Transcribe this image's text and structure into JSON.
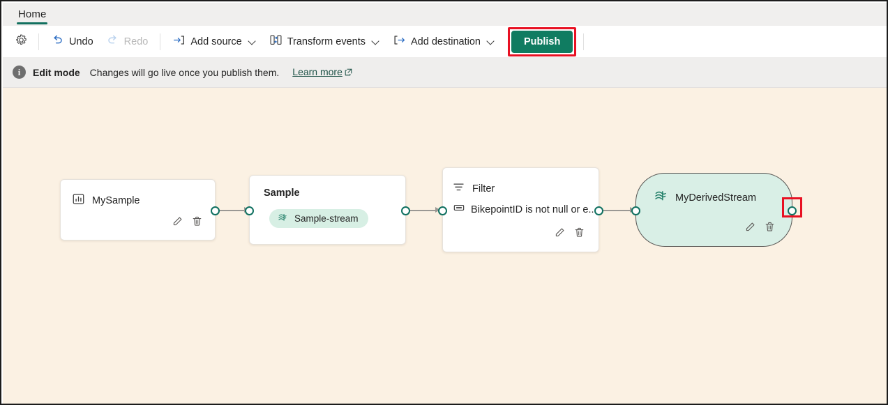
{
  "window": {
    "accent_green": "#107c61",
    "canvas_background": "#fbf1e3",
    "annotation_color": "#e81123"
  },
  "tabstrip": {
    "tabs": [
      {
        "label": "Home",
        "selected": true
      }
    ]
  },
  "toolbar": {
    "settings_label": "Settings",
    "items": [
      {
        "id": "settings",
        "label": "",
        "icon": "gear-icon",
        "enabled": true,
        "has_chevron": false
      },
      {
        "id": "undo",
        "label": "Undo",
        "icon": "undo-icon",
        "enabled": true,
        "has_chevron": false
      },
      {
        "id": "redo",
        "label": "Redo",
        "icon": "redo-icon",
        "enabled": false,
        "has_chevron": false
      },
      {
        "id": "add-source",
        "label": "Add source",
        "icon": "arrow-into-bracket-icon",
        "enabled": true,
        "has_chevron": true
      },
      {
        "id": "transform-events",
        "label": "Transform events",
        "icon": "transform-events-icon",
        "enabled": true,
        "has_chevron": true
      },
      {
        "id": "add-destination",
        "label": "Add destination",
        "icon": "bracket-arrow-out-icon",
        "enabled": true,
        "has_chevron": true
      }
    ],
    "undo_label": "Undo",
    "redo_label": "Redo",
    "add_source_label": "Add source",
    "transform_events_label": "Transform events",
    "add_destination_label": "Add destination",
    "publish_label": "Publish",
    "publish_highlighted": true
  },
  "infobar": {
    "icon": "info-icon",
    "badge": "i",
    "title": "Edit mode",
    "message": "Changes will go live once you publish them.",
    "link_label": "Learn more",
    "link_icon": "external-link-icon"
  },
  "canvas": {
    "nodes": [
      {
        "id": "mysample",
        "type": "source",
        "title": "MySample",
        "icon": "chart-source-icon",
        "actions": [
          "edit-icon",
          "delete-icon"
        ],
        "ports": {
          "output": true,
          "input": false
        }
      },
      {
        "id": "sample",
        "type": "stream",
        "title": "Sample",
        "pill_label": "Sample-stream",
        "pill_icon": "stream-icon",
        "actions": [],
        "ports": {
          "output": true,
          "input": true
        }
      },
      {
        "id": "filter",
        "type": "operator",
        "title": "Filter",
        "icon": "filter-icon",
        "condition_label": "BikepointID is not null or e...",
        "condition_icon": "field-icon",
        "actions": [
          "edit-icon",
          "delete-icon"
        ],
        "ports": {
          "output": true,
          "input": true
        }
      },
      {
        "id": "myderivedstream",
        "type": "derived-stream",
        "title": "MyDerivedStream",
        "icon": "stream-icon",
        "actions": [
          "edit-icon",
          "delete-icon"
        ],
        "ports": {
          "output": true,
          "input": true
        },
        "output_port_highlighted": true
      }
    ]
  }
}
